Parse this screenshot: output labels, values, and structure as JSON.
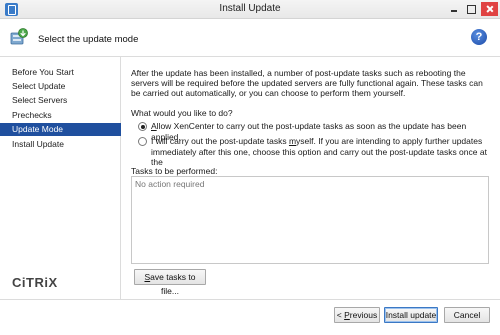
{
  "window": {
    "title": "Install Update"
  },
  "header": {
    "title": "Select the update mode"
  },
  "sidebar": {
    "items": [
      {
        "label": "Before You Start"
      },
      {
        "label": "Select Update"
      },
      {
        "label": "Select Servers"
      },
      {
        "label": "Prechecks"
      },
      {
        "label": "Update Mode"
      },
      {
        "label": "Install Update"
      }
    ],
    "active_index": 4,
    "logo_text": "CiTRiX"
  },
  "main": {
    "intro": "After the update has been installed, a number of post-update tasks such as rebooting the servers will be required before the updated servers are fully functional again. These tasks can be carried out automatically, or you can choose to perform them yourself.",
    "question": "What would you like to do?",
    "options": [
      {
        "pre": "",
        "key": "A",
        "post": "llow XenCenter to carry out the post-update tasks as soon as the update has been applied.",
        "checked": true
      },
      {
        "pre": "I will carry out the post-update tasks ",
        "key": "m",
        "post": "yself. If you are intending to apply further updates immediately after this one, choose this option and carry out the post-update tasks once at the",
        "checked": false
      }
    ],
    "tasks_label": "Tasks to be performed:",
    "tasks_empty": "No action required",
    "save_tasks": {
      "key": "S",
      "rest": "ave tasks to file..."
    }
  },
  "footer": {
    "previous": {
      "pre": "< ",
      "key": "P",
      "rest": "revious"
    },
    "install": "Install update",
    "cancel": "Cancel"
  }
}
